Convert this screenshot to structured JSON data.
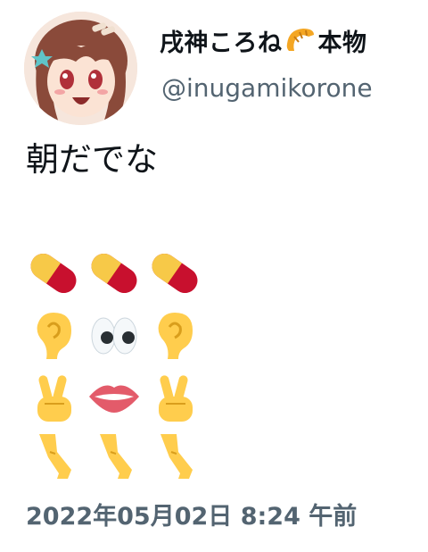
{
  "author": {
    "display_name": "戌神ころね",
    "name_suffix": "本物",
    "handle": "@inugamikorone"
  },
  "tweet": {
    "text": "朝だでな",
    "emoji_rows": [
      [
        "pill",
        "pill",
        "pill"
      ],
      [
        "ear",
        "eyes",
        "ear"
      ],
      [
        "victory-hand",
        "mouth",
        "victory-hand"
      ],
      [
        "leg",
        "leg",
        "leg"
      ]
    ]
  },
  "meta": {
    "timestamp": "2022年05月02日 8:24 午前"
  },
  "colors": {
    "text": "#0f1419",
    "secondary": "#536471"
  }
}
